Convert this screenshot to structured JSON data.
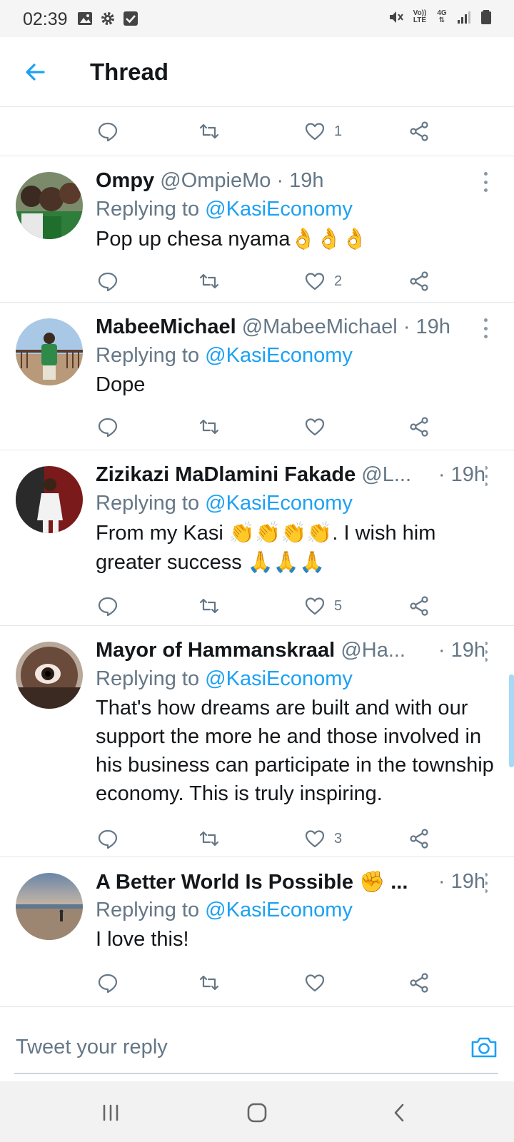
{
  "status_bar": {
    "time": "02:39",
    "net_top": "Vo))",
    "net_bottom": "LTE",
    "net_4g": "4G"
  },
  "app_bar": {
    "title": "Thread",
    "back_icon": "arrow-left-icon"
  },
  "top_actions": {
    "like_count": "1"
  },
  "tweets": [
    {
      "name": "Ompy",
      "handle": "@OmpieMo",
      "time": "· 19h",
      "replying_prefix": "Replying to",
      "replying_to": "@KasiEconomy",
      "text": "Pop up chesa nyama",
      "emoji": "👌👌👌",
      "like_count": "2"
    },
    {
      "name": "MabeeMichael",
      "handle": "@MabeeMichael",
      "time": "· 19h",
      "replying_prefix": "Replying to",
      "replying_to": "@KasiEconomy",
      "text": "Dope",
      "like_count": ""
    },
    {
      "name": "Zizikazi MaDlamini Fakade",
      "handle": "@L...",
      "time": "· 19h",
      "replying_prefix": "Replying to",
      "replying_to": "@KasiEconomy",
      "text_part1": "From my Kasi",
      "emoji_clap": "👏👏👏👏",
      "text_part2": ". I wish him greater success",
      "emoji_pray": "🙏🙏🙏",
      "like_count": "5"
    },
    {
      "name": "Mayor of Hammanskraal",
      "handle": "@Ha...",
      "time": "· 19h",
      "replying_prefix": "Replying to",
      "replying_to": "@KasiEconomy",
      "text": "That's how dreams are built and with our support the more he and those involved in his business can participate in the township economy. This is truly inspiring.",
      "like_count": "3"
    },
    {
      "name": "A Better World Is Possible",
      "name_emoji": "✊",
      "name_ellipsis": "...",
      "handle": "",
      "time": "· 19h",
      "replying_prefix": "Replying to",
      "replying_to": "@KasiEconomy",
      "text": "I love this!",
      "like_count": ""
    }
  ],
  "composer": {
    "placeholder": "Tweet your reply",
    "camera_icon": "camera-icon"
  },
  "colors": {
    "accent": "#1da1f2",
    "secondary_text": "#657786",
    "divider": "#e1e8ed"
  }
}
